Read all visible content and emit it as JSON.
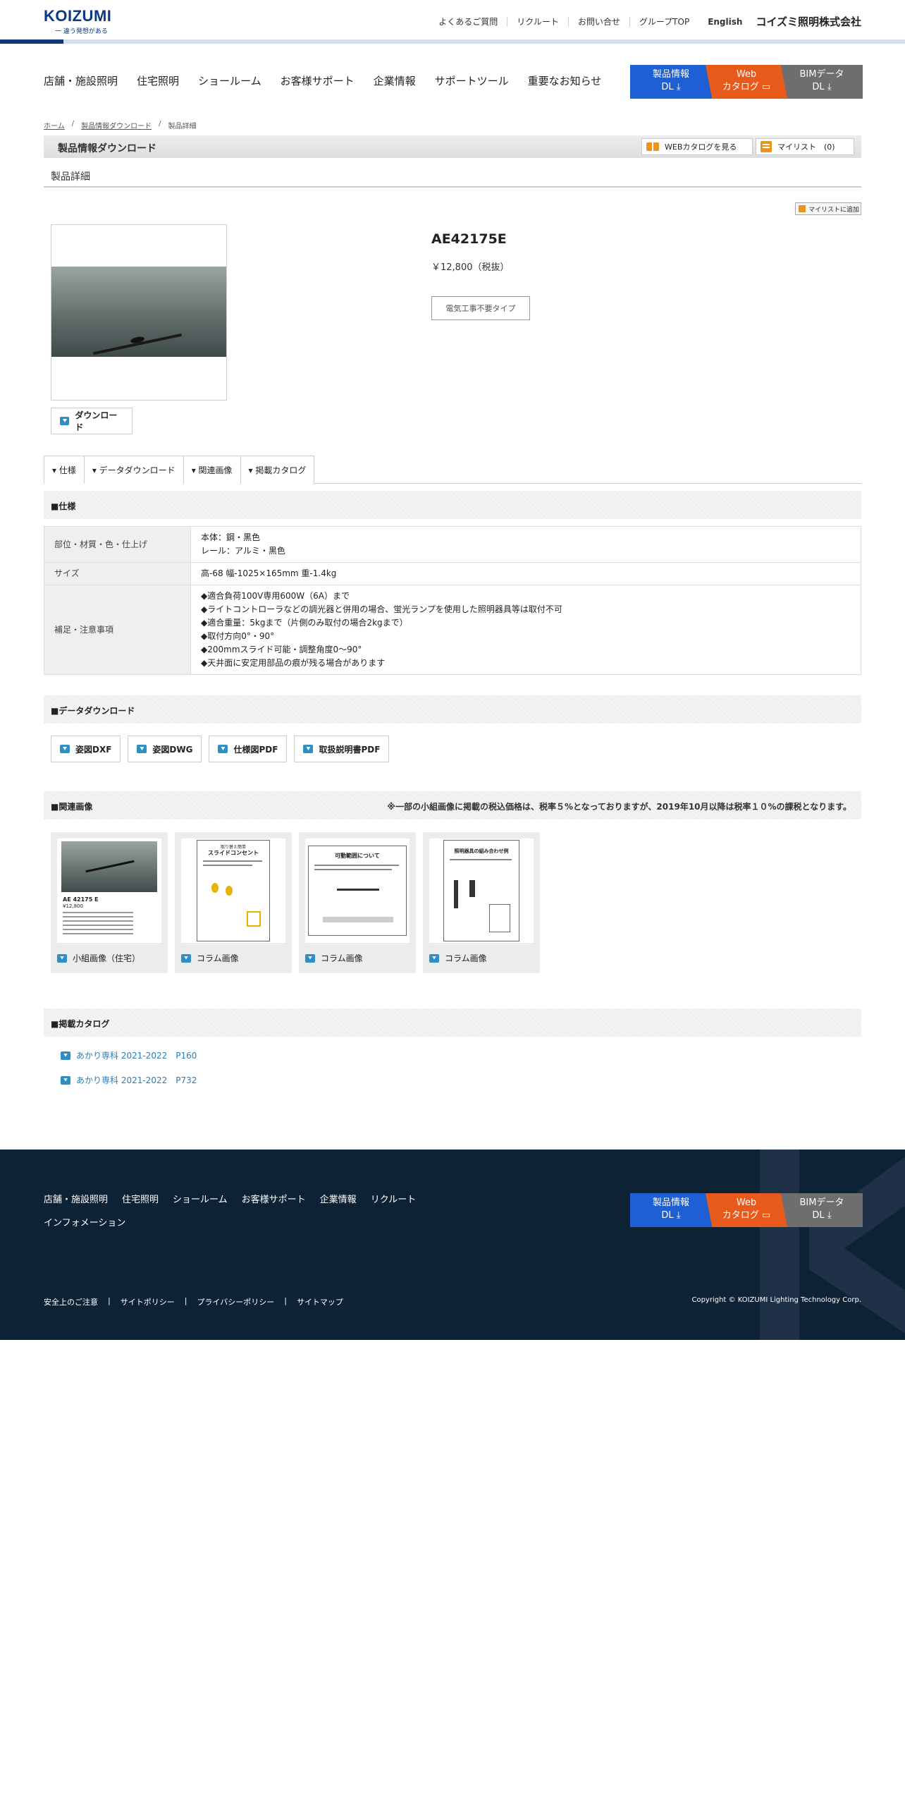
{
  "header": {
    "logo": "KOIZUMI",
    "tagline": "一 違う発想がある",
    "utility": [
      "よくあるご質問",
      "リクルート",
      "お問い合せ",
      "グループTOP"
    ],
    "english": "English",
    "corp_name": "コイズミ照明株式会社"
  },
  "gnav": [
    "店舗・施設照明",
    "住宅照明",
    "ショールーム",
    "お客様サポート",
    "企業情報",
    "サポートツール",
    "重要なお知らせ"
  ],
  "dl_buttons": {
    "product": "製品情報\nDL",
    "web": "Web\nカタログ",
    "bim": "BIMデータ\nDL"
  },
  "breadcrumb": [
    "ホーム",
    "製品情報ダウンロード",
    "製品詳細"
  ],
  "section_header": {
    "title": "製品情報ダウンロード",
    "web_catalog": "WEBカタログを見る",
    "mylist": "マイリスト　(0)"
  },
  "page_subtitle": "製品詳細",
  "add_to_list": "マイリストに追加",
  "product": {
    "code": "AE42175E",
    "price": "￥12,800（税抜）",
    "tag": "電気工事不要タイプ",
    "download": "ダウンロード"
  },
  "tabs": [
    "▾ 仕様",
    "▾ データダウンロード",
    "▾ 関連画像",
    "▾ 掲載カタログ"
  ],
  "spec": {
    "title": "■仕様",
    "rows": [
      {
        "label": "部位・材質・色・仕上げ",
        "value": "本体：鋼・黒色\nレール：アルミ・黒色"
      },
      {
        "label": "サイズ",
        "value": "高-68 幅-1025×165mm 重-1.4kg"
      },
      {
        "label": "補足・注意事項",
        "value": "◆適合負荷100V専用600W（6A）まで\n◆ライトコントローラなどの調光器と併用の場合、蛍光ランプを使用した照明器具等は取付不可\n◆適合重量：5kgまで（片側のみ取付の場合2kgまで）\n◆取付方向0°・90°\n◆200mmスライド可能・調整角度0～90°\n◆天井面に安定用部品の痕が残る場合があります"
      }
    ]
  },
  "data_download": {
    "title": "■データダウンロード",
    "items": [
      "姿図DXF",
      "姿図DWG",
      "仕様図PDF",
      "取扱説明書PDF"
    ]
  },
  "related": {
    "title": "■関連画像",
    "note": "※一部の小組画像に掲載の税込価格は、税率５%となっておりますが、2019年10月以降は税率１０%の課税となります。",
    "items": [
      "小組画像（住宅）",
      "コラム画像",
      "コラム画像",
      "コラム画像"
    ],
    "thumb_text": {
      "code": "AE 42175 E",
      "price": "¥12,800",
      "slide_title": "スライドコンセント",
      "slide_sub": "取り替え簡単",
      "range_title": "可動範囲について",
      "combo_title": "照明器具の組み合わせ例"
    }
  },
  "catalog": {
    "title": "■掲載カタログ",
    "items": [
      "あかり専科 2021-2022　P160",
      "あかり専科 2021-2022　P732"
    ]
  },
  "footer": {
    "nav": [
      "店舗・施設照明",
      "住宅照明",
      "ショールーム",
      "お客様サポート",
      "企業情報",
      "リクルート",
      "インフォメーション"
    ],
    "links": [
      "安全上のご注意",
      "サイトポリシー",
      "プライバシーポリシー",
      "サイトマップ"
    ],
    "copyright": "Copyright © KOIZUMI Lighting Technology Corp."
  },
  "colors": {
    "brand": "#0b3a7e",
    "blue": "#1e5fd6",
    "orange": "#e85a1b",
    "gray": "#6e6e6e",
    "footer": "#0e2235",
    "link": "#2a7db8"
  }
}
